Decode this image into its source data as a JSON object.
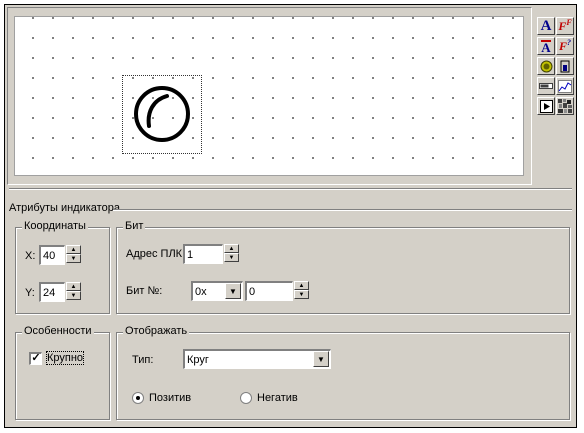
{
  "toolbar": {
    "tools": [
      {
        "name": "text-tool-icon",
        "glyph": "A",
        "color": "#00008b"
      },
      {
        "name": "dynamic-text-tool-icon",
        "glyph": "F",
        "color": "#c00000"
      },
      {
        "name": "text-indicator-tool-icon",
        "glyph": "Ā",
        "color": "#00008b"
      },
      {
        "name": "formula-tool-icon",
        "glyph": "F",
        "color": "#c00000"
      },
      {
        "name": "lamp-indicator-tool-icon",
        "glyph": "◎",
        "color": "#808000"
      },
      {
        "name": "bar-tool-icon",
        "glyph": "▮",
        "color": "#404040"
      },
      {
        "name": "bargraph-tool-icon",
        "glyph": "▤",
        "color": "#404040"
      },
      {
        "name": "trend-tool-icon",
        "glyph": "⟋",
        "color": "#0000c0"
      },
      {
        "name": "button-tool-icon",
        "glyph": "▶",
        "color": "#000000"
      },
      {
        "name": "bitmap-tool-icon",
        "glyph": "▦",
        "color": "#404040"
      }
    ]
  },
  "props": {
    "section_title": "Атрибуты индикатора",
    "coords": {
      "legend": "Координаты",
      "x_label": "X:",
      "x_value": "40",
      "y_label": "Y:",
      "y_value": "24"
    },
    "bit": {
      "legend": "Бит",
      "plc_address_label": "Адрес ПЛК",
      "plc_address_value": "1",
      "bit_no_label": "Бит №:",
      "bit_prefix_value": "0x",
      "bit_no_value": "0"
    },
    "features": {
      "legend": "Особенности",
      "large_label": "Крупно",
      "large_checked": true
    },
    "display": {
      "legend": "Отображать",
      "type_label": "Тип:",
      "type_value": "Круг",
      "positive_label": "Позитив",
      "negative_label": "Негатив",
      "selected": "positive"
    }
  }
}
